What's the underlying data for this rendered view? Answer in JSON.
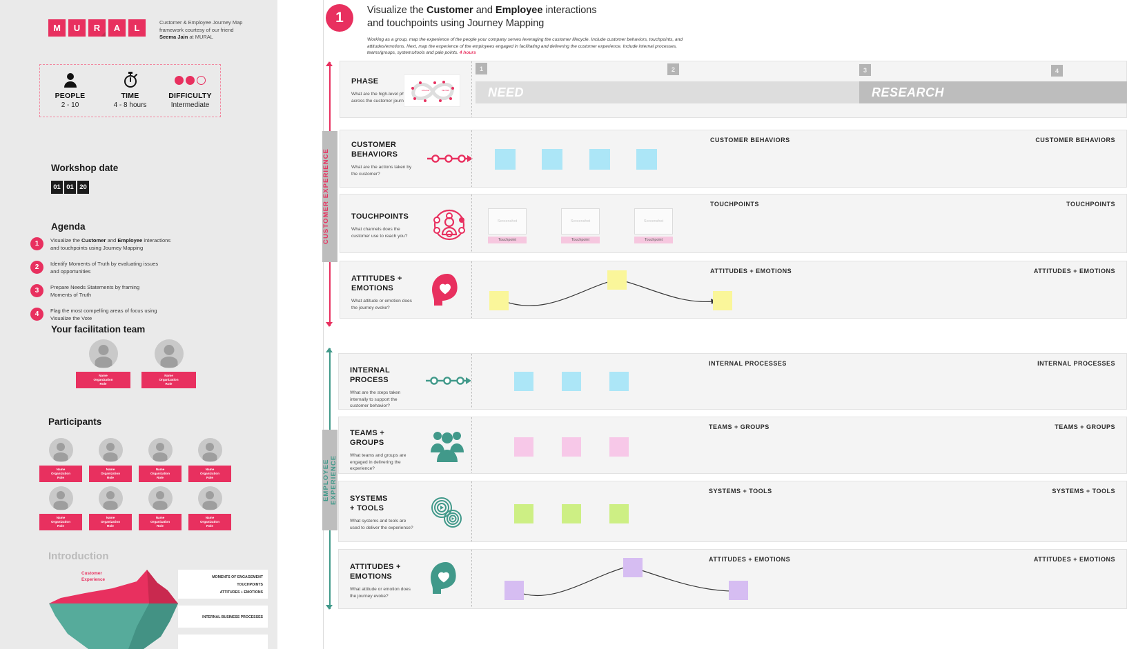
{
  "sidebar": {
    "logo_letters": [
      "M",
      "U",
      "R",
      "A",
      "L"
    ],
    "logo_caption_line1": "Customer & Employee Journey Map",
    "logo_caption_line2": "framework courtesy of our friend",
    "logo_caption_author": "Seema Jain",
    "logo_caption_suffix": " at MURAL",
    "meta": [
      {
        "icon": "person-icon",
        "title": "PEOPLE",
        "value": "2 - 10"
      },
      {
        "icon": "stopwatch-icon",
        "title": "TIME",
        "value": "4 - 8 hours"
      },
      {
        "icon": "difficulty-dots-icon",
        "title": "DIFFICULTY",
        "value": "Intermediate"
      }
    ],
    "difficulty_filled": 2,
    "difficulty_total": 3,
    "workshop_date_heading": "Workshop date",
    "workshop_date": [
      "01",
      "01",
      "20"
    ],
    "agenda_heading": "Agenda",
    "agenda": [
      {
        "num": "1",
        "line1_pre": "Visualize the ",
        "b1": "Customer",
        "mid": " and ",
        "b2": "Employee",
        "line1_post": " interactions",
        "line2": "and touchpoints using Journey Mapping"
      },
      {
        "num": "2",
        "line1_pre": "Identify Moments of Truth by evaluating issues",
        "b1": "",
        "mid": "",
        "b2": "",
        "line1_post": "",
        "line2": "and opportunities"
      },
      {
        "num": "3",
        "line1_pre": "Prepare Needs Statements by framing",
        "b1": "",
        "mid": "",
        "b2": "",
        "line1_post": "",
        "line2": "Moments of Truth"
      },
      {
        "num": "4",
        "line1_pre": "Flag the most compelling areas of focus using",
        "b1": "",
        "mid": "",
        "b2": "",
        "line1_post": "",
        "line2": "Visualize the Vote"
      }
    ],
    "facilitation_heading": "Your facilitation team",
    "facilitators": [
      {
        "name": "Name",
        "org": "Organization",
        "role": "Role"
      },
      {
        "name": "Name",
        "org": "Organization",
        "role": "Role"
      }
    ],
    "participants_heading": "Participants",
    "participants": [
      {
        "name": "Name",
        "org": "Organization",
        "role": "Role"
      },
      {
        "name": "Name",
        "org": "Organization",
        "role": "Role"
      },
      {
        "name": "Name",
        "org": "Organization",
        "role": "Role"
      },
      {
        "name": "Name",
        "org": "Organization",
        "role": "Role"
      },
      {
        "name": "Name",
        "org": "Organization",
        "role": "Role"
      },
      {
        "name": "Name",
        "org": "Organization",
        "role": "Role"
      },
      {
        "name": "Name",
        "org": "Organization",
        "role": "Role"
      },
      {
        "name": "Name",
        "org": "Organization",
        "role": "Role"
      }
    ],
    "introduction_heading": "Introduction",
    "iceberg": {
      "above_label_line1": "Customer",
      "above_label_line2": "Experience",
      "callout1_line1": "MOMENTS OF ENGAGEMENT",
      "callout1_line2": "TOUCHPOINTS",
      "callout1_line3": "ATTITUDES + EMOTIONS",
      "callout2_line1": "INTERNAL BUSINESS PROCESSES"
    }
  },
  "step": {
    "number": "1",
    "title_pre": "Visualize the ",
    "title_b1": "Customer",
    "title_mid": " and ",
    "title_b2": "Employee",
    "title_post": " interactions",
    "title_line2": "and touchpoints using Journey Mapping",
    "description": "Working as a group, map the experience of the people your company serves leveraging the customer lifecycle. Include customer behaviors, touchpoints, and attitudes/emotions. Next, map the experience of the employees engaged in facilitating and delivering the customer experience. Include internal processes, teams/groups, systems/tools and pain points.",
    "duration": "4 hours"
  },
  "phase_row": {
    "title": "PHASE",
    "question": "What are the high-level phases across the customer journey?",
    "icon": "infinity-lifecycle-icon",
    "columns": [
      {
        "marker": "1",
        "label": "NEED"
      },
      {
        "marker": "2",
        "label": ""
      },
      {
        "marker": "3",
        "label": "RESEARCH"
      },
      {
        "marker": "4",
        "label": ""
      }
    ]
  },
  "customer_experience": {
    "rail_label": "CUSTOMER EXPERIENCE",
    "accent": "#e8305f",
    "rows": [
      {
        "title_line1": "CUSTOMER",
        "title_line2": "BEHAVIORS",
        "question": "What are the actions taken by the customer?",
        "icon": "process-arrow-icon",
        "right_caps": [
          "CUSTOMER BEHAVIORS",
          "CUSTOMER BEHAVIORS"
        ],
        "note_color": "#ace6f7",
        "note_count": 4
      },
      {
        "title_line1": "TOUCHPOINTS",
        "title_line2": "",
        "question": "What channels does the customer use to reach you?",
        "icon": "touchpoint-network-icon",
        "right_caps": [
          "TOUCHPOINTS",
          "TOUCHPOINTS"
        ],
        "card_placeholder": "Screenshot",
        "card_label": "Touchpoint",
        "card_count": 3
      },
      {
        "title_line1": "ATTITUDES +",
        "title_line2": "EMOTIONS",
        "question": "What attitude or emotion does the journey evoke?",
        "icon": "head-heart-icon",
        "right_caps": [
          "ATTITUDES + EMOTIONS",
          "ATTITUDES + EMOTIONS"
        ],
        "note_color": "#faf69a",
        "note_count": 3
      }
    ]
  },
  "employee_experience": {
    "rail_label": "EMPLOYEE  EXPERIENCE",
    "accent": "#41998a",
    "rows": [
      {
        "title_line1": "INTERNAL",
        "title_line2": "PROCESS",
        "question": "What are the steps taken internally to support the customer behavior?",
        "icon": "process-arrow-icon",
        "right_caps": [
          "INTERNAL PROCESSES",
          "INTERNAL PROCESSES"
        ],
        "note_color": "#ace6f7",
        "note_count": 3
      },
      {
        "title_line1": "TEAMS +",
        "title_line2": "GROUPS",
        "question": "What teams and groups are engaged in delivering the experience?",
        "icon": "people-group-icon",
        "right_caps": [
          "TEAMS + GROUPS",
          "TEAMS + GROUPS"
        ],
        "note_color": "#f7c8e8",
        "note_count": 3
      },
      {
        "title_line1": "SYSTEMS",
        "title_line2": "+ TOOLS",
        "question": "What systems and tools are used to deliver the experience?",
        "icon": "gears-icon",
        "right_caps": [
          "SYSTEMS + TOOLS",
          "SYSTEMS + TOOLS"
        ],
        "note_color": "#cdef84",
        "note_count": 3
      },
      {
        "title_line1": "ATTITUDES +",
        "title_line2": "EMOTIONS",
        "question": "What attitude or emotion does the journey evoke?",
        "icon": "head-heart-icon",
        "right_caps": [
          "ATTITUDES + EMOTIONS",
          "ATTITUDES + EMOTIONS"
        ],
        "note_color": "#d6bdf2",
        "note_count": 3
      }
    ]
  }
}
